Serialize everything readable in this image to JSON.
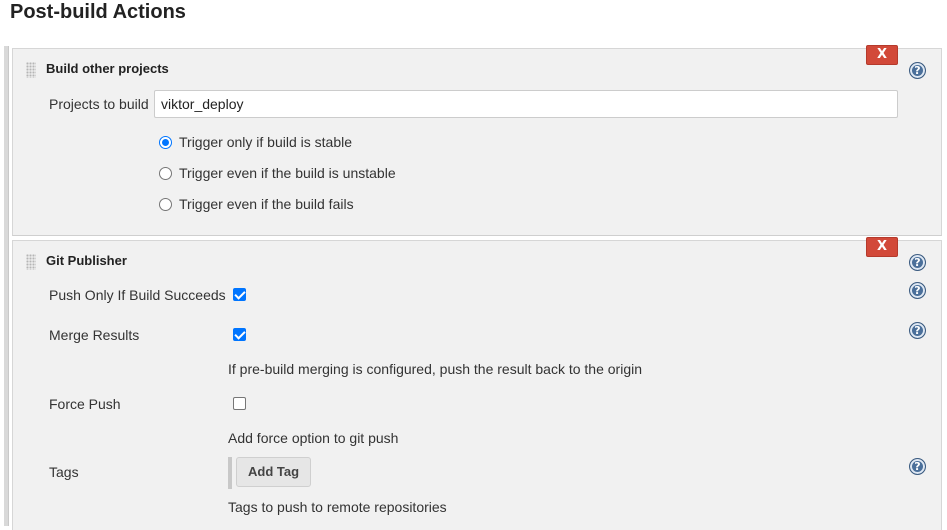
{
  "page": {
    "title": "Post-build Actions"
  },
  "build_other_projects": {
    "title": "Build other projects",
    "delete_label": "X",
    "help_label": "?",
    "projects_label": "Projects to build",
    "projects_value": "viktor_deploy",
    "options": [
      {
        "label": "Trigger only if build is stable",
        "checked": true
      },
      {
        "label": "Trigger even if the build is unstable",
        "checked": false
      },
      {
        "label": "Trigger even if the build fails",
        "checked": false
      }
    ]
  },
  "git_publisher": {
    "title": "Git Publisher",
    "delete_label": "X",
    "help_label": "?",
    "push_only_label": "Push Only If Build Succeeds",
    "push_only_checked": true,
    "merge_label": "Merge Results",
    "merge_checked": true,
    "merge_desc": "If pre-build merging is configured, push the result back to the origin",
    "force_label": "Force Push",
    "force_checked": false,
    "force_desc": "Add force option to git push",
    "tags_label": "Tags",
    "add_tag_label": "Add Tag",
    "tags_desc": "Tags to push to remote repositories"
  },
  "colors": {
    "accent": "#0075ff",
    "delete": "#d24939",
    "help": "#4a6f9a"
  }
}
